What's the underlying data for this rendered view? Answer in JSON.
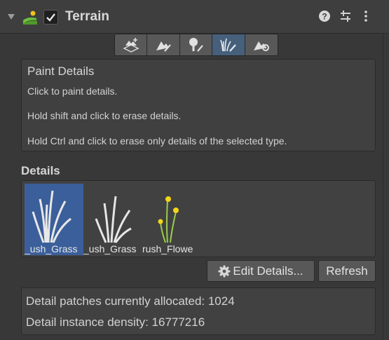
{
  "component": {
    "title": "Terrain",
    "enabled": true
  },
  "header_icons": [
    "help-icon",
    "preset-sliders-icon",
    "more-vertical-icon"
  ],
  "toolbar": {
    "tools": [
      {
        "name": "create-neighbor-terrains-tool-icon",
        "active": false
      },
      {
        "name": "paint-terrain-tool-icon",
        "active": false
      },
      {
        "name": "paint-trees-tool-icon",
        "active": false
      },
      {
        "name": "paint-details-tool-icon",
        "active": true
      },
      {
        "name": "terrain-settings-tool-icon",
        "active": false
      }
    ]
  },
  "help": {
    "title": "Paint Details",
    "lines": [
      "Click to paint details.",
      "Hold shift and click to erase details.",
      "Hold Ctrl and click to erase only details of the selected type."
    ]
  },
  "details": {
    "label": "Details",
    "items": [
      {
        "label": "ush_Grass_",
        "selected": true
      },
      {
        "label": "ush_Grass_",
        "selected": false
      },
      {
        "label": "rush_Flowe",
        "selected": false
      }
    ]
  },
  "buttons": {
    "edit_details": "Edit Details...",
    "refresh": "Refresh"
  },
  "info": {
    "patches": "Detail patches currently allocated: 1024",
    "density": "Detail instance density: 16777216"
  },
  "colors": {
    "background": "#383838",
    "selection": "#3b5f9a",
    "active_tool": "#46607c"
  }
}
